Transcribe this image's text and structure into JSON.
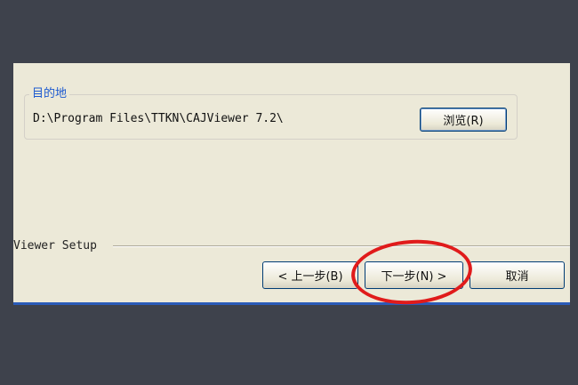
{
  "destination": {
    "group_title": "目的地",
    "path": "D:\\Program Files\\TTKN\\CAJViewer 7.2\\",
    "browse_label": "浏览(R)"
  },
  "footer": {
    "setup_label": "Viewer Setup",
    "back_label": "< 上一步(B)",
    "next_label": "下一步(N) >",
    "cancel_label": "取消"
  },
  "colors": {
    "highlight_circle": "#e01b1b",
    "dialog_background": "#ece9d8"
  }
}
